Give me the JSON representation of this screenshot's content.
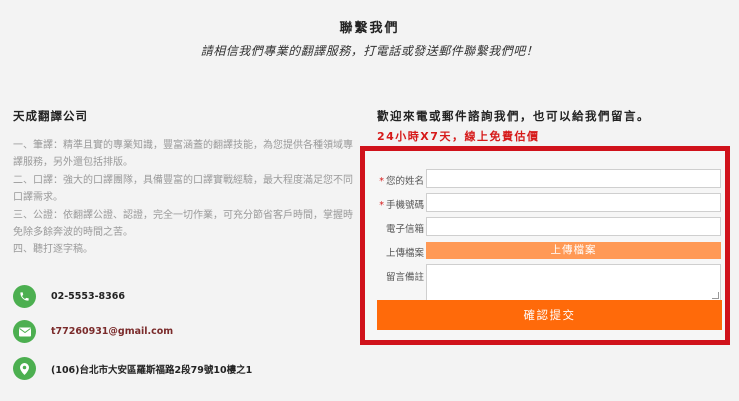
{
  "header": {
    "title": "聯繫我們",
    "subtitle": "請相信我們專業的翻譯服務，打電話或發送郵件聯繫我們吧！"
  },
  "company": {
    "name": "天成翻譯公司",
    "services": [
      "一、筆譯：精準且實的專業知識，豐富涵蓋的翻譯技能，為您提供各種領域專業的筆",
      "譯服務，另外還包括排版。",
      "二、口譯：強大的口譯團隊，具備豐富的口譯實戰經驗，最大程度滿足您不同類型的",
      "口譯需求。",
      "三、公證：依翻譯公證、認證，完全一切作業，可充分節省客戶時間，掌握時效，",
      "免除多餘奔波的時間之苦。",
      "四、聽打逐字稿。"
    ],
    "contacts": {
      "phone": "02-5553-8366",
      "email": "t77260931@gmail.com",
      "address": "(106)台北市大安區羅斯福路2段79號10樓之1"
    }
  },
  "form_section": {
    "heading": "歡迎來電或郵件諮詢我們，也可以給我們留言。",
    "promo": "24小時X7天，線上免費估價",
    "labels": {
      "name": "您的姓名",
      "phone": "手機號碼",
      "email": "電子信箱",
      "upload": "上傳檔案",
      "message": "留言備註"
    },
    "required_mark": "*",
    "upload_button": "上傳檔案",
    "submit_button": "確認提交",
    "values": {
      "name": "",
      "phone": "",
      "email": "",
      "message": ""
    }
  },
  "colors": {
    "form_border": "#d0121b",
    "upload_button": "#ff9955",
    "submit_button": "#ff6a0a",
    "icon_green": "#4caf50",
    "promo_red": "#d61a1a"
  }
}
